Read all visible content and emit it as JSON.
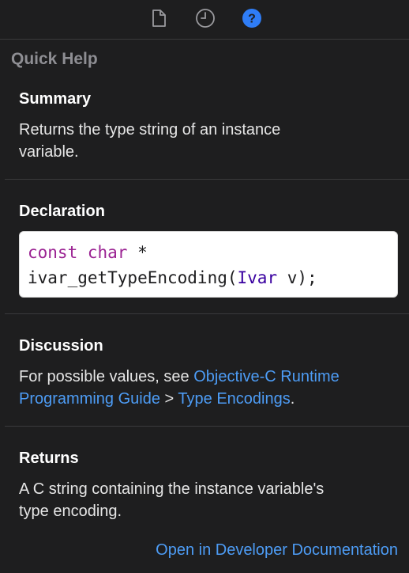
{
  "toolbar": {
    "icons": [
      "file-inspector-icon",
      "history-inspector-icon",
      "quick-help-icon"
    ],
    "active_color": "#2f7df6",
    "inactive_color": "#9a9a9e"
  },
  "panel": {
    "title": "Quick Help"
  },
  "summary": {
    "title": "Summary",
    "line1": "Returns the type string of an instance",
    "line2": "variable."
  },
  "declaration": {
    "title": "Declaration",
    "kw_const": "const",
    "kw_char": "char",
    "ptr": " *",
    "func": "ivar_getTypeEncoding(",
    "param_type": "Ivar",
    "param_rest": " v);"
  },
  "discussion": {
    "title": "Discussion",
    "prefix": "For possible values, see ",
    "link1_part1": "Objective-C Runtime",
    "link1_part2": "Programming Guide",
    "separator": " > ",
    "link2": "Type Encodings",
    "suffix": "."
  },
  "returns": {
    "title": "Returns",
    "line1": "A C string containing the instance variable's",
    "line2": "type encoding."
  },
  "footer": {
    "open_docs_link": "Open in Developer Documentation"
  },
  "colors": {
    "background": "#1e1e1f",
    "link": "#4d9cf5",
    "keyword": "#9b2393",
    "type": "#3900a0"
  }
}
